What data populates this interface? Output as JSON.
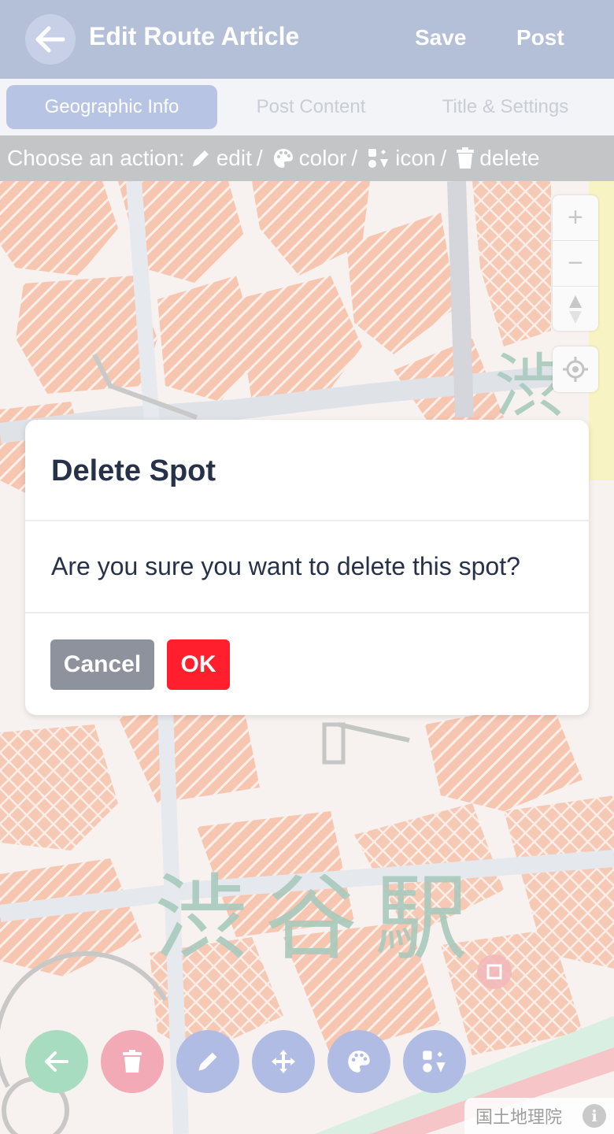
{
  "header": {
    "title": "Edit Route Article",
    "save_label": "Save",
    "post_label": "Post"
  },
  "tabs": [
    {
      "label": "Geographic Info",
      "active": true
    },
    {
      "label": "Post Content",
      "active": false
    },
    {
      "label": "Title & Settings",
      "active": false
    }
  ],
  "action_bar": {
    "prefix": "Choose an action:",
    "edit": "edit",
    "color": "color",
    "icon": "icon",
    "delete": "delete",
    "separator": "/"
  },
  "map": {
    "station_label": "渋谷駅",
    "top_label": "渋",
    "zoom_in": "+",
    "zoom_out": "−",
    "attribution": "国土地理院",
    "info": "i"
  },
  "dialog": {
    "title": "Delete Spot",
    "message": "Are you sure you want to delete this spot?",
    "cancel_label": "Cancel",
    "ok_label": "OK"
  },
  "colors": {
    "header_bg": "#b4c0d8",
    "ok": "#ff1f2d",
    "cancel": "#8d929d",
    "fab_back": "#a8dcc1",
    "fab_delete": "#f2aab6",
    "fab_tool": "#b0bce3"
  },
  "fab_icons": [
    "arrow-left-icon",
    "trash-icon",
    "pencil-icon",
    "move-icon",
    "palette-icon",
    "icons-icon"
  ]
}
